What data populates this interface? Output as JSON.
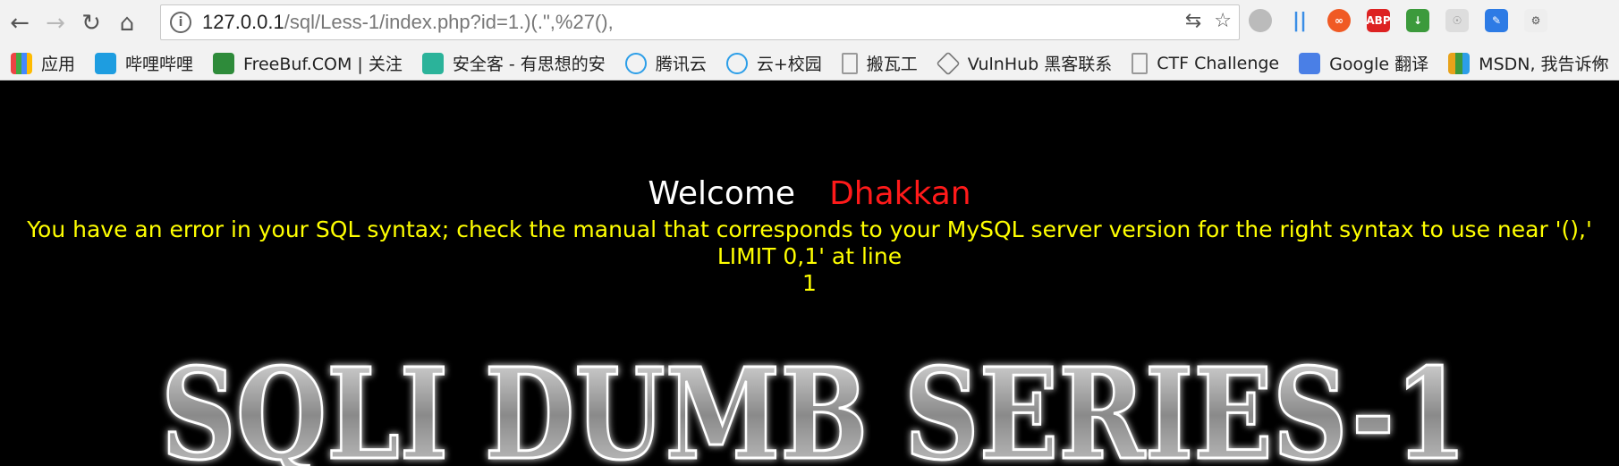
{
  "browser": {
    "url_host": "127.0.0.1",
    "url_path": "/sql/Less-1/index.php?id=1.)(.\",%27(),"
  },
  "bookmarks": [
    {
      "label": "应用",
      "color": "#e44"
    },
    {
      "label": "哔哩哔哩",
      "color": "#1e9de0"
    },
    {
      "label": "FreeBuf.COM | 关注",
      "color": "#2e8b3a"
    },
    {
      "label": "安全客 - 有思想的安",
      "color": "#2bb39a"
    },
    {
      "label": "腾讯云",
      "color": "#2c9ee8"
    },
    {
      "label": "云+校园",
      "color": "#2c9ee8"
    },
    {
      "label": "搬瓦工",
      "color": "#999"
    },
    {
      "label": "VulnHub 黑客联系",
      "color": "#777"
    },
    {
      "label": "CTF Challenge",
      "color": "#999"
    },
    {
      "label": "Google 翻译",
      "color": "#4a7fe6"
    },
    {
      "label": "MSDN, 我告诉你",
      "color": "#e8a21a"
    }
  ],
  "page": {
    "welcome": "Welcome",
    "name": "Dhakkan",
    "error_line1": "You have an error in your SQL syntax; check the manual that corresponds to your MySQL server version for the right syntax to use near '(),' LIMIT 0,1' at line",
    "error_line2": "1",
    "banner": "SQLI DUMB SERIES-1"
  },
  "colors": {
    "name": "#ff1a1a",
    "error": "#ffff00"
  },
  "icons": [
    "back-arrow-icon",
    "forward-arrow-icon",
    "reload-icon",
    "home-icon",
    "info-icon",
    "translate-icon",
    "star-icon",
    "more-icon"
  ]
}
